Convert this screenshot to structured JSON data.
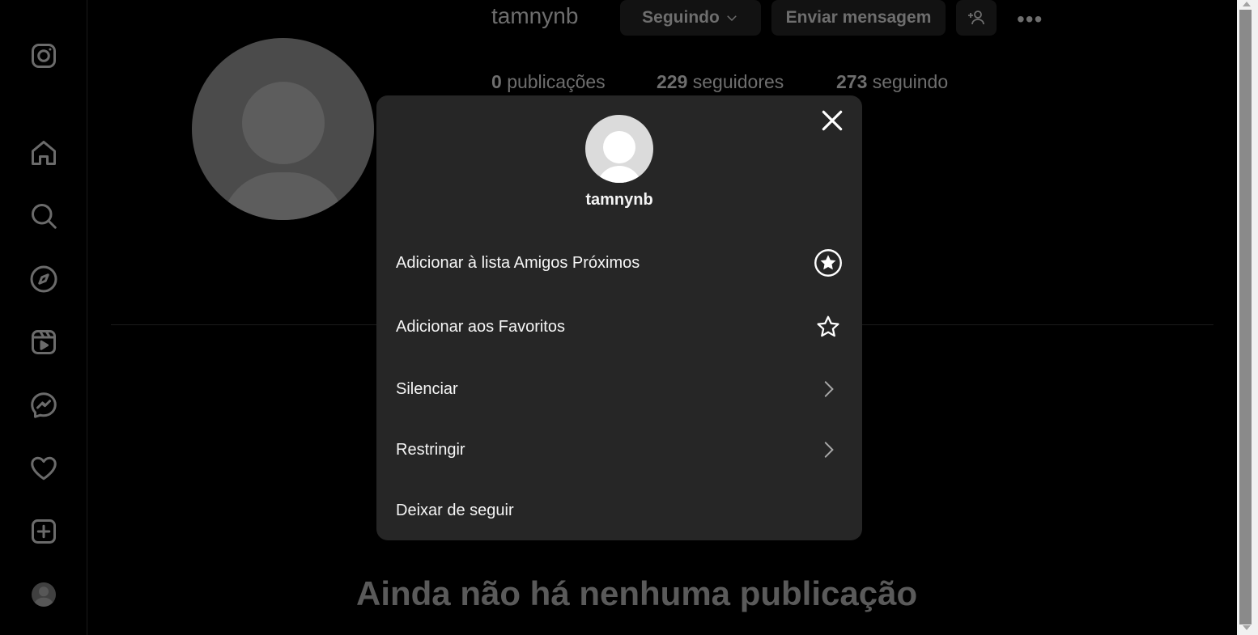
{
  "profile": {
    "username": "tamnynb",
    "following_button": "Seguindo",
    "message_button": "Enviar mensagem",
    "stats": {
      "posts_count": "0",
      "posts_label": "publicações",
      "followers_count": "229",
      "followers_label": "seguidores",
      "following_count": "273",
      "following_label": "seguindo"
    },
    "empty_state": "Ainda não há nenhuma publicação"
  },
  "sidebar": {
    "icons": [
      "instagram-icon",
      "home-icon",
      "search-icon",
      "explore-icon",
      "reels-icon",
      "messenger-icon",
      "heart-icon",
      "create-icon",
      "profile-avatar"
    ]
  },
  "modal": {
    "username": "tamnynb",
    "items": [
      {
        "label": "Adicionar à lista Amigos Próximos",
        "icon": "close-friends-star-icon"
      },
      {
        "label": "Adicionar aos Favoritos",
        "icon": "star-outline-icon"
      },
      {
        "label": "Silenciar",
        "icon": "chevron-right-icon"
      },
      {
        "label": "Restringir",
        "icon": "chevron-right-icon"
      },
      {
        "label": "Deixar de seguir",
        "icon": ""
      }
    ]
  },
  "colors": {
    "background": "#000000",
    "modal_bg": "#262626",
    "dimmed_text": "#6e6e6e",
    "text": "#f5f5f5"
  }
}
